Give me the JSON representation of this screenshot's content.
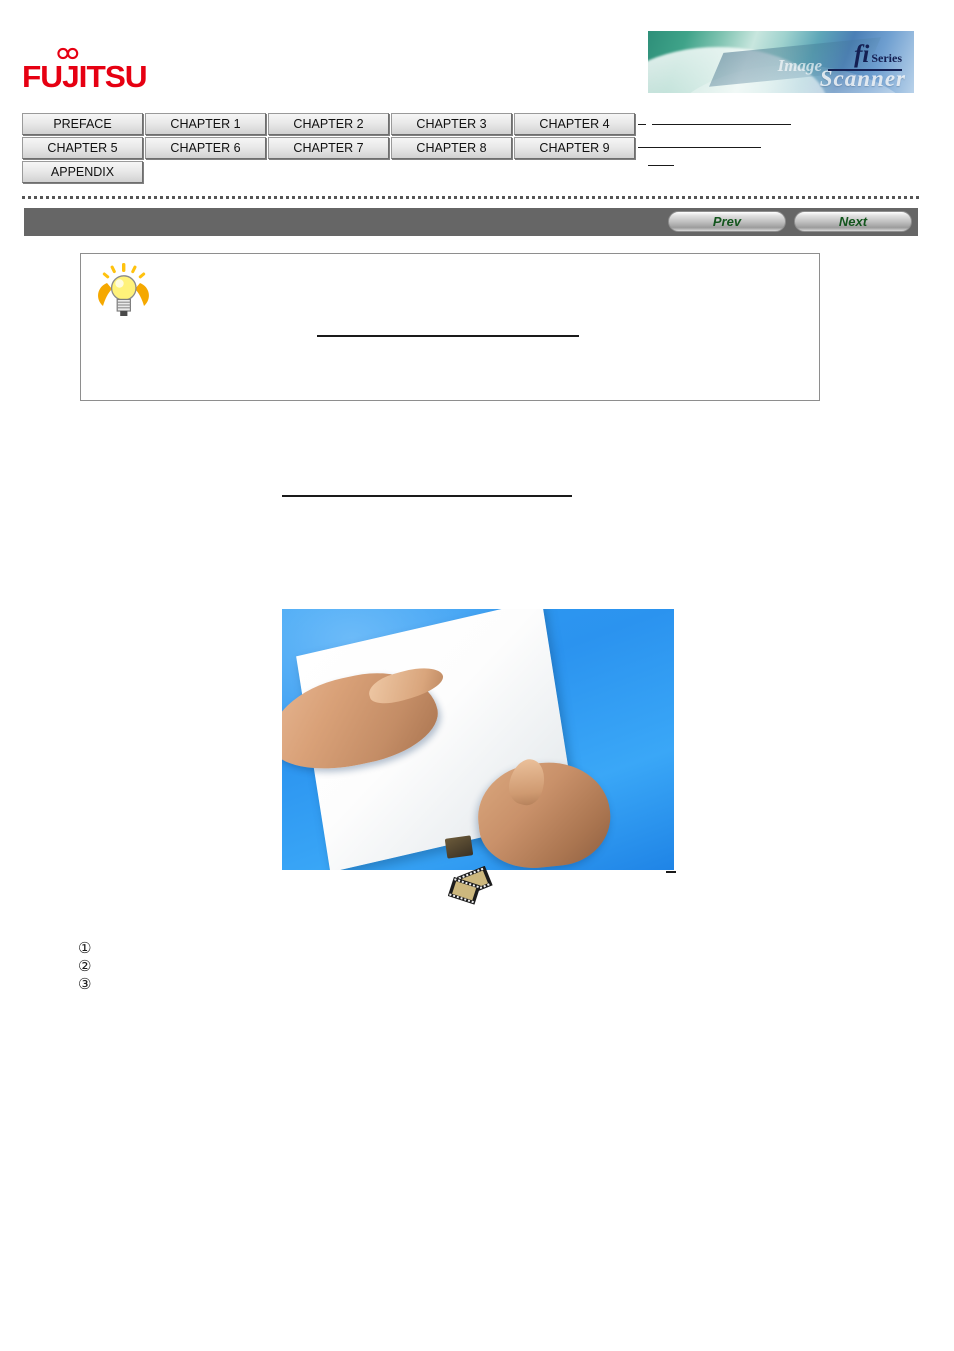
{
  "page": {
    "title": "fi Series Image Scanner",
    "background_color": "#ffffff"
  },
  "header": {
    "logo": {
      "name": "FUJITSU",
      "wordmark": "FUJITSU",
      "color": "#e60012",
      "icon": "infinity-mark"
    },
    "banner": {
      "fi": "fi",
      "series": "Series",
      "image_word": "Image",
      "scanner_word": "Scanner",
      "accent_color": "#141f52"
    },
    "links": [
      {
        "label": "",
        "rule": true
      },
      {
        "label": "",
        "rule": true
      },
      {
        "label": "",
        "rule": true
      }
    ]
  },
  "tab_nav": {
    "rows": [
      [
        {
          "label": "PREFACE"
        },
        {
          "label": "CHAPTER 1"
        },
        {
          "label": "CHAPTER 2"
        },
        {
          "label": "CHAPTER 3"
        },
        {
          "label": "CHAPTER 4"
        }
      ],
      [
        {
          "label": "CHAPTER 5"
        },
        {
          "label": "CHAPTER 6"
        },
        {
          "label": "CHAPTER 7"
        },
        {
          "label": "CHAPTER 8"
        },
        {
          "label": "CHAPTER 9"
        }
      ],
      [
        {
          "label": "APPENDIX"
        }
      ]
    ]
  },
  "nav_bar": {
    "background_color": "#666666",
    "prev_label": "Prev",
    "next_label": "Next",
    "label_color": "#14561e"
  },
  "hint_box": {
    "icon": "lightbulb-icon",
    "icon_color": "#ffd42a",
    "border_color": "#8e8e8e",
    "rule": true
  },
  "content": {
    "body_rule": true,
    "photo": {
      "name": "hands-holding-paper-stack-photo",
      "background_color": "#2f9cf2"
    },
    "film_icon": "film-clip-icon",
    "numbered_list": [
      {
        "marker": "①",
        "text": ""
      },
      {
        "marker": "②",
        "text": ""
      },
      {
        "marker": "③",
        "text": ""
      }
    ]
  }
}
